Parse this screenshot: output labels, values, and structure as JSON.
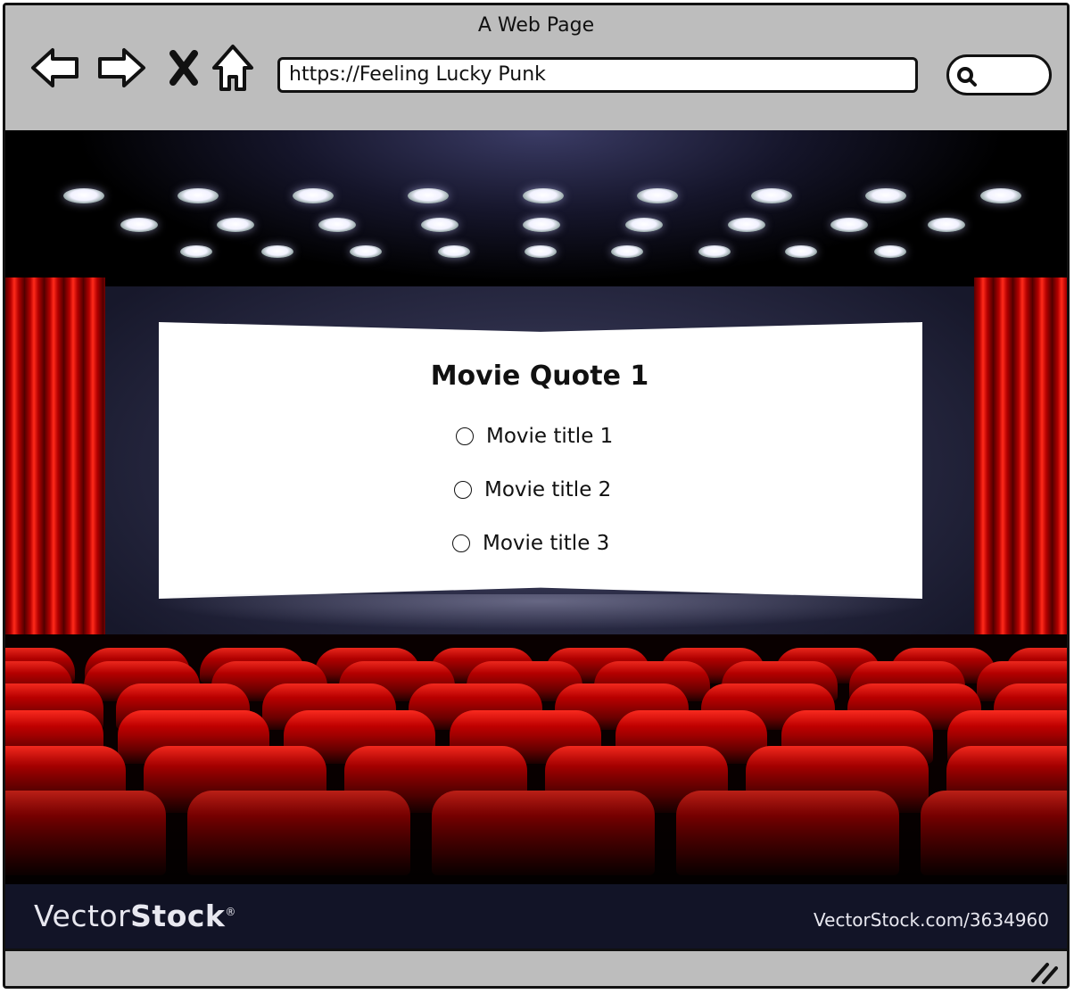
{
  "window": {
    "title": "A Web Page",
    "url": "https://Feeling Lucky Punk"
  },
  "nav": {
    "back_icon": "arrow-left-icon",
    "forward_icon": "arrow-right-icon",
    "stop_icon": "close-icon",
    "home_icon": "home-icon",
    "search_icon": "search-icon"
  },
  "quiz": {
    "question": "Movie Quote 1",
    "options": [
      "Movie title 1",
      "Movie title 2",
      "Movie title 3"
    ]
  },
  "footer": {
    "brand_light": "Vector",
    "brand_bold": "Stock",
    "brand_mark": "®",
    "url": "VectorStock.com/3634960"
  },
  "colors": {
    "chrome": "#bdbdbd",
    "curtain": "#c00000",
    "screen": "#ffffff",
    "footer": "#121427"
  }
}
